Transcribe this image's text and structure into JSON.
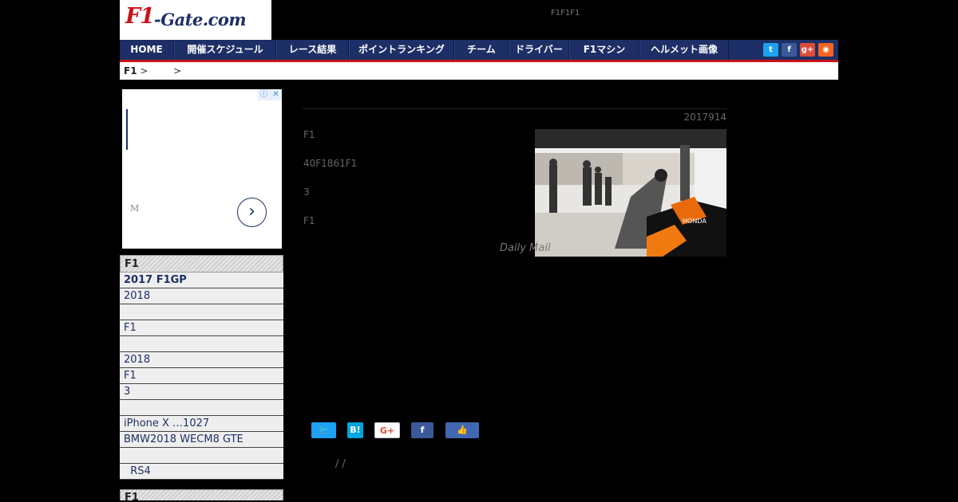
{
  "header": {
    "logo_primary": "F1",
    "logo_secondary": "-Gate.com",
    "tagline": "F1F1F1"
  },
  "nav": {
    "items": [
      "HOME",
      "開催スケジュール",
      "レース結果",
      "ポイントランキング",
      "チーム",
      "ドライバー",
      "F1マシン",
      "ヘルメット画像"
    ]
  },
  "social_icons": [
    {
      "name": "twitter-icon",
      "color": "#1da1f2",
      "glyph": "t"
    },
    {
      "name": "facebook-icon",
      "color": "#3b5998",
      "glyph": "f"
    },
    {
      "name": "google-plus-icon",
      "color": "#dd4b39",
      "glyph": "g+"
    },
    {
      "name": "rss-icon",
      "color": "#f26522",
      "glyph": "◉"
    }
  ],
  "breadcrumb": {
    "home": "F1",
    "sep1": " >",
    "sep2": ">"
  },
  "ad": {
    "label": "M",
    "arrow": "›",
    "info": "ⓘ",
    "close": "✕"
  },
  "sidebar": {
    "section1_title": "F1",
    "items": [
      {
        "label": "2017 F1GP",
        "bold": true
      },
      {
        "label": "2018",
        "bold": false
      },
      {
        "label": "",
        "bold": false
      },
      {
        "label": "F1",
        "bold": false
      },
      {
        "label": "",
        "bold": false
      },
      {
        "label": "2018",
        "bold": false
      },
      {
        "label": "F1",
        "bold": false
      },
      {
        "label": "3",
        "bold": false
      },
      {
        "label": "",
        "bold": false
      },
      {
        "label": "iPhone X …1027",
        "bold": false
      },
      {
        "label": "BMW2018 WECM8 GTE",
        "bold": false
      },
      {
        "label": "",
        "bold": false
      },
      {
        "label": "  RS4",
        "bold": false
      }
    ],
    "section2_title": "F1"
  },
  "article": {
    "date": "2017914",
    "paragraphs": [
      "F1",
      "40F1861F1",
      "3",
      "F1"
    ],
    "caption": "Daily Mail"
  },
  "share_buttons": [
    {
      "name": "twitter-share-button",
      "label": "🐦",
      "color": "#1da1f2"
    },
    {
      "name": "hatena-share-button",
      "label": "B!",
      "color": "#00a4de"
    },
    {
      "name": "google-plus-share-button",
      "label": "G+",
      "color": "#ffffff"
    },
    {
      "name": "facebook-share-button",
      "label": "f",
      "color": "#3b5998"
    },
    {
      "name": "like-button",
      "label": "👍",
      "color": "#4267b2"
    }
  ],
  "article_nav": "/  /"
}
